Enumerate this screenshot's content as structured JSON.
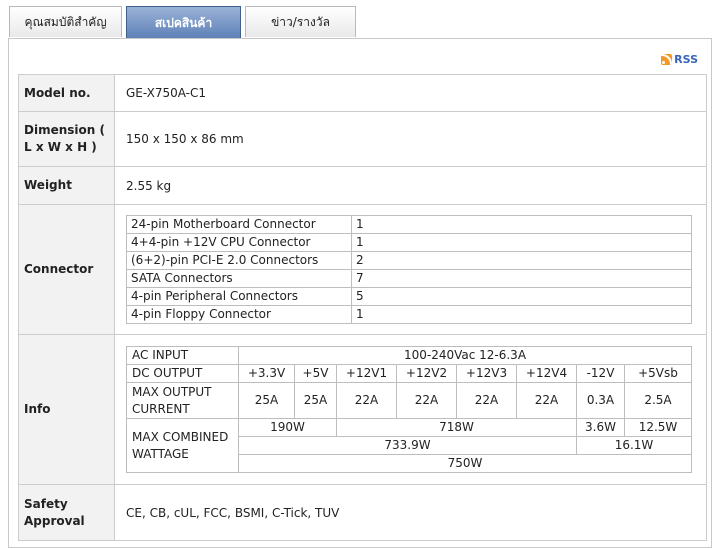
{
  "tabs": [
    {
      "label": "คุณสมบัติสำคัญ",
      "active": false
    },
    {
      "label": "สเปคสินค้า",
      "active": true
    },
    {
      "label": "ข่าว/รางวัล",
      "active": false
    }
  ],
  "rss": {
    "label": "RSS"
  },
  "specs": {
    "model": {
      "label": "Model no.",
      "value": "GE-X750A-C1"
    },
    "dimension": {
      "label": "Dimension ( L x W x H )",
      "value": "150 x 150 x 86 mm"
    },
    "weight": {
      "label": "Weight",
      "value": "2.55 kg"
    },
    "connector": {
      "label": "Connector",
      "rows": [
        {
          "name": "24-pin Motherboard Connector",
          "count": "1"
        },
        {
          "name": "4+4-pin +12V CPU Connector",
          "count": "1"
        },
        {
          "name": "(6+2)-pin PCI-E 2.0 Connectors",
          "count": "2"
        },
        {
          "name": "SATA Connectors",
          "count": "7"
        },
        {
          "name": "4-pin Peripheral Connectors",
          "count": "5"
        },
        {
          "name": "4-pin Floppy Connector",
          "count": "1"
        }
      ]
    },
    "info": {
      "label": "Info",
      "ac_input_label": "AC INPUT",
      "ac_input_value": "100-240Vac 12-6.3A",
      "dc_output_label": "DC OUTPUT",
      "dc_outputs": [
        "+3.3V",
        "+5V",
        "+12V1",
        "+12V2",
        "+12V3",
        "+12V4",
        "-12V",
        "+5Vsb"
      ],
      "max_output_label": "MAX OUTPUT CURRENT",
      "max_outputs": [
        "25A",
        "25A",
        "22A",
        "22A",
        "22A",
        "22A",
        "0.3A",
        "2.5A"
      ],
      "max_combined_label": "MAX COMBINED WATTAGE",
      "combined_low_rail": "190W",
      "combined_12v": "718W",
      "combined_neg12": "3.6W",
      "combined_5vsb": "12.5W",
      "combined_main": "733.9W",
      "combined_aux": "16.1W",
      "total": "750W"
    },
    "safety": {
      "label": "Safety Approval",
      "value": "CE, CB, cUL, FCC, BSMI, C-Tick, TUV"
    }
  }
}
